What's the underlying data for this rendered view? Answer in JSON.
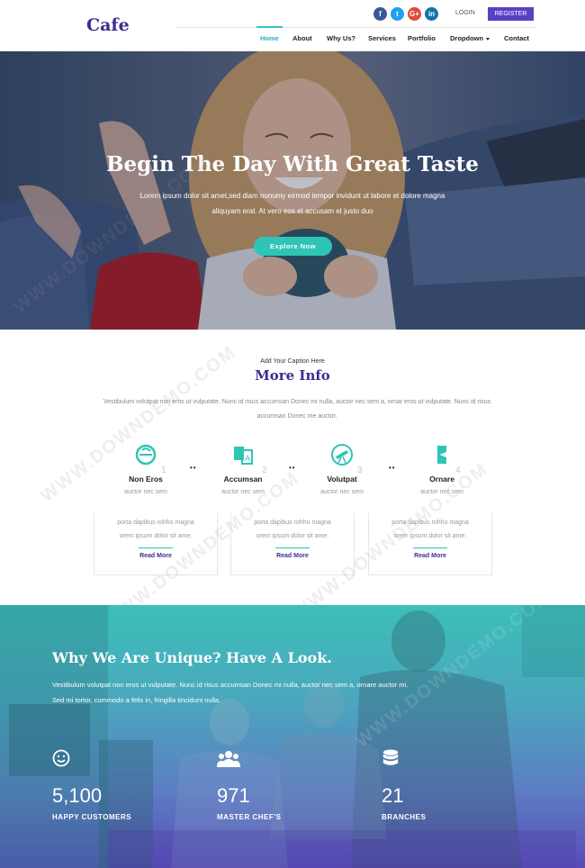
{
  "header": {
    "logo": "Cafe",
    "social": [
      "f",
      "t",
      "G+",
      "in"
    ],
    "login": "LOGIN",
    "register": "REGISTER",
    "nav": [
      "Home",
      "About",
      "Why Us?",
      "Services",
      "Portfolio",
      "Dropdown",
      "Contact"
    ]
  },
  "hero": {
    "title": "Begin The Day With Great Taste",
    "subtitle": "Lorem ipsum dolor sit amet,sed diam nonumy eirmod tempor invidunt ut labore et dolore magna aliquyam erat. At vero eos et accusam et justo duo",
    "button": "Explore Now"
  },
  "info": {
    "caption": "Add Your Caption Here",
    "title": "More Info",
    "description": "Vestibulum volutpat non eros ut vulputate. Nunc id risus accumsan Donec mi nulla, auctor nec sem a, ornar eros ut vulputate. Nunc id risus accumsan Donec me auctor.",
    "steps": [
      {
        "title": "Non Eros",
        "sub": "auctor nec sem",
        "num": "1"
      },
      {
        "title": "Accumsan",
        "sub": "auctor nec sem",
        "num": "2"
      },
      {
        "title": "Volutpat",
        "sub": "auctor nec sem",
        "num": "3"
      },
      {
        "title": "Ornare",
        "sub": "auctor nec sem",
        "num": "4"
      }
    ],
    "connector": "••",
    "cards": [
      {
        "line1": "porta dapibus rohho magna",
        "line2": "orem ipsum dolor sit ame.",
        "link": "Read More"
      },
      {
        "line1": "porta dapibus rohho magna",
        "line2": "orem ipsum dolor sit ame.",
        "link": "Read More"
      },
      {
        "line1": "porta dapibus rohho magna",
        "line2": "orem ipsum dolor sit ame.",
        "link": "Read More"
      }
    ]
  },
  "unique": {
    "title": "Why We Are Unique? Have A Look.",
    "description": "Vestibulum volutpat non eros ut vulputate. Nunc id risus accumsan Donec mi nulla, auctor nec sem a, ornare auctor mi. Sed mi tortor, commodo a felis in, fringilla tincidunt nulla.",
    "stats": [
      {
        "value": "5,100",
        "label": "HAPPY CUSTOMERS",
        "icon": "smile-icon"
      },
      {
        "value": "971",
        "label": "MASTER CHEF'S",
        "icon": "users-icon"
      },
      {
        "value": "21",
        "label": "BRANCHES",
        "icon": "database-icon"
      }
    ]
  },
  "watermark": "WWW.DOWNDEMO.COM"
}
